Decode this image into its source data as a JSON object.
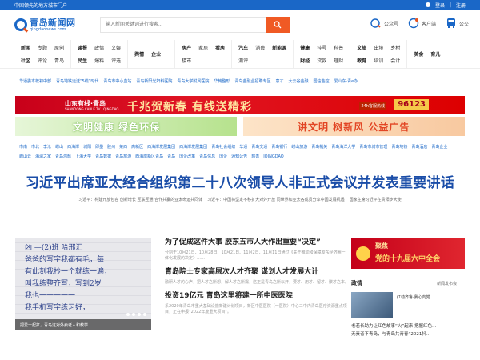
{
  "topbar": {
    "slogan": "中国领先的地方城市门户",
    "login": "登录",
    "register": "注册",
    "sep": "|"
  },
  "logo": {
    "cn": "青岛新闻网",
    "en": "qingdaonews.com"
  },
  "search": {
    "placeholder": "输入新闻关键词进行搜索..."
  },
  "header_links": [
    {
      "label": "公众号",
      "color": "#e8541e"
    },
    {
      "label": "客户端",
      "color": "#e8541e"
    },
    {
      "label": "公交",
      "color": "#1a67c7"
    }
  ],
  "nav": [
    [
      {
        "l": "新闻",
        "b": true
      },
      {
        "l": "专题"
      },
      {
        "l": "原创"
      },
      {
        "l": "社区",
        "b": true
      },
      {
        "l": "评论"
      },
      {
        "l": "青岛"
      }
    ],
    [
      {
        "l": "读报",
        "b": true
      },
      {
        "l": "政情"
      },
      {
        "l": "文娱"
      },
      {
        "l": "民生",
        "b": true
      },
      {
        "l": "爆料"
      },
      {
        "l": "评选"
      }
    ],
    [
      {
        "l": "舆情",
        "b": true
      },
      {
        "l": "企业",
        "b": true
      }
    ],
    [
      {
        "l": "房产",
        "b": true
      },
      {
        "l": "家居"
      },
      {
        "l": "看房",
        "b": true
      },
      {
        "l": "楼市"
      }
    ],
    [
      {
        "l": "汽车",
        "b": true
      },
      {
        "l": "消费"
      },
      {
        "l": "新能源",
        "b": true
      },
      {
        "l": "测评"
      }
    ],
    [
      {
        "l": "健康",
        "b": true
      },
      {
        "l": "挂号"
      },
      {
        "l": "科普"
      },
      {
        "l": "财经",
        "b": true
      },
      {
        "l": "贷款"
      },
      {
        "l": "理财"
      }
    ],
    [
      {
        "l": "文旅",
        "b": true
      },
      {
        "l": "出境"
      },
      {
        "l": "乡村"
      },
      {
        "l": "教育",
        "b": true
      },
      {
        "l": "培训"
      },
      {
        "l": "会计"
      }
    ],
    [
      {
        "l": "美食",
        "b": true
      },
      {
        "l": "育儿",
        "b": true
      }
    ]
  ],
  "hot_links": [
    "华通委本校初中部",
    "青岛地铁运送“5线”时代",
    "青岛市中心血站",
    "青岛新阳光妇科医院",
    "青岛大学附属医院",
    "华韩整形",
    "青岛金融业招聘专区",
    "意才",
    "大云谷金融",
    "国信金控",
    "爱山东·青e办"
  ],
  "banner1": {
    "brand": "山东有线·青岛",
    "brand_en": "SHANDONG CABLE TV · QINGDAO",
    "slogan": "千兆贺新春 有线送精彩",
    "hotline_label": "24h客服热线",
    "hotline": "96123"
  },
  "banner2": {
    "left": "文明健康 绿色环保",
    "right": "讲文明 树新风 公益广告"
  },
  "city_links": [
    "市南",
    "市北",
    "李沧",
    "崂山",
    "西海岸",
    "城阳",
    "即墨",
    "胶州",
    "莱西",
    "高新区",
    "西海岸发展集团",
    "西海岸发展集团",
    "青岛社会组织",
    "华通",
    "青岛交通",
    "青岛银行",
    "崂山旅游",
    "青岛机关",
    "青岛海洋大学",
    "青岛市城市管理",
    "青岛地铁",
    "青岛酒店",
    "青岛企业",
    "崂山云",
    "海澜之家",
    "青岛鸿辉",
    "上海大学",
    "青岛数据",
    "青岛旅游",
    "西海岸新区青岛",
    "青岛",
    "国企改革",
    "青岛信息",
    "国企",
    "通知公告",
    "慈善",
    "IQINGDAO"
  ],
  "headline": "习近平出席亚太经合组织第二十八次领导人非正式会议并发表重要讲话",
  "sublines": [
    "习近平：构建开放包容 创新增长 互联互通 合作共赢的亚太命运共同体",
    "习近平：中国将坚定不移扩大对外开放 同世界和亚太各成员分享中国发展机遇",
    "国家主席习近平在贵阳步大使"
  ],
  "photo": {
    "lines": [
      "凶 —(2)班 哈邢汇",
      "爸爸的写字我都有毛，每",
      "有此刻我抄一个就练一遍，",
      "叫我练整齐写，写到2岁",
      "我也一一一一一",
      "我手机写字练习好，"
    ],
    "caption": "把爱一起扛，青岛这对外卖老人和教学"
  },
  "news": [
    {
      "title": "为了促成这件大事 胶东五市人大作出重要“决定”",
      "desc": "分别于10月21日、10月28日、10月21日、11月2日、11月11日通过《关于推动和保障胶东经济圈一体化发展的决定》……"
    },
    {
      "title": "青岛院士专家高层次人才齐聚 谋划人才发展大计",
      "desc": "融研人才的心声，把人才之所想，解人才之所需，这正是青岛之所以开，要才、用才、留才、聚才之本。"
    },
    {
      "title": "投资19亿元 青岛这里将建一所中医医院",
      "desc": "系2020年青岛市重大基础设施新建计划项目，新区中医医院（一医院）中心三中内青岛医疗资源重点项目，正在申报“2022年度重大项目”。"
    }
  ],
  "side": {
    "banner_top": "聚焦",
    "banner_title": "党的十九届六中全会",
    "section_title": "政情",
    "section_more": "新闻发布会",
    "thumb_title": "红动齐鲁·我心向党",
    "list": [
      "老若长助力让红色故事“火”起来 把握红色…",
      "无责者不青岛，与青岛共青春“2021抖…"
    ]
  }
}
